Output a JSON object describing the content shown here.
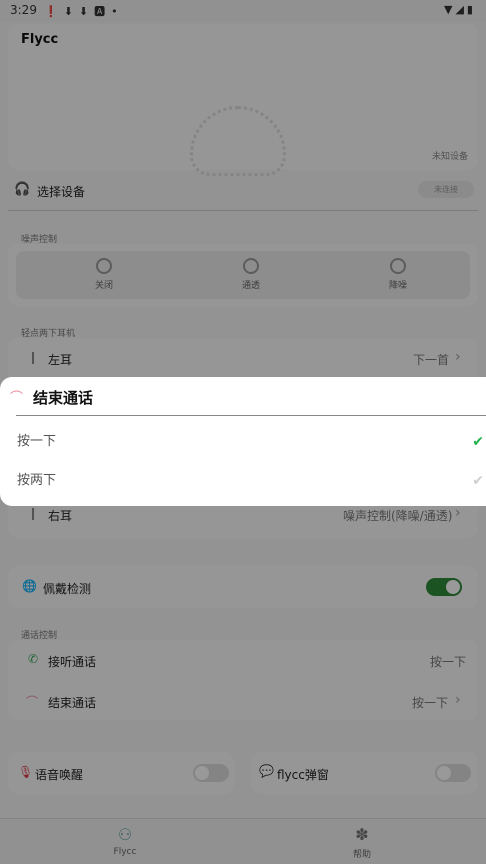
{
  "status_bar": {
    "time": "3:29",
    "left_icons": "❗⬇⬇🅰•",
    "right_icons": "▼◢▮"
  },
  "device": {
    "name": "Flycc",
    "status": "未知设备"
  },
  "select_device": {
    "label": "选择设备",
    "button": "未连接"
  },
  "noise_control": {
    "section": "噪声控制",
    "options": [
      "关闭",
      "通透",
      "降噪"
    ]
  },
  "tap_section": "轻点两下耳机",
  "left_ear": {
    "label": "左耳",
    "value": "下一首"
  },
  "right_ear": {
    "label": "右耳",
    "value": "噪声控制(降噪/通透)"
  },
  "wear_detection": {
    "label": "佩戴检测",
    "on": true
  },
  "call_control": {
    "section": "通话控制",
    "answer": {
      "label": "接听通话",
      "value": "按一下"
    },
    "end": {
      "label": "结束通话",
      "value": "按一下"
    }
  },
  "voice_wake": {
    "label": "语音唤醒",
    "on": false
  },
  "popup": {
    "label": "flycc弹窗",
    "on": false
  },
  "nav": {
    "flycc": "Flycc",
    "help": "帮助"
  },
  "sheet": {
    "title": "结束通话",
    "options": [
      {
        "label": "按一下",
        "selected": true
      },
      {
        "label": "按两下",
        "selected": false
      }
    ]
  },
  "colors": {
    "accent_green": "#2e8b3a",
    "check_green": "#22b14c",
    "end_call_pink": "#e98a9a"
  },
  "icons": {
    "headphones": "headphones-icon",
    "globe": "globe-icon",
    "phone": "phone-icon",
    "hangup": "hangup-icon",
    "mic": "mic-icon",
    "chat": "chat-icon"
  }
}
